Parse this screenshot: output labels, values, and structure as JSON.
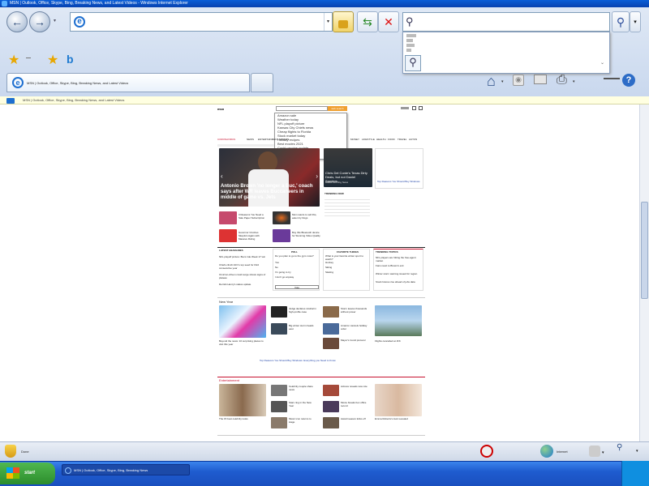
{
  "window": {
    "title": "MSN | Outlook, Office, Skype, Bing, Breaking News, and Latest Videos - Windows Internet Explorer"
  },
  "toolbar": {
    "address_value": "",
    "search_value": "",
    "search_dropdown_item": "Bing"
  },
  "tab": {
    "label": "MSN | Outlook, Office, Skype, Bing, Breaking News, and Latest Videos"
  },
  "infobar": {
    "text": "MSN | Outlook, Office, Skype, Bing, Breaking News, and Latest Videos"
  },
  "msn": {
    "logo": "msn",
    "search_button": "web search",
    "search_suggestions": [
      "Amazon sale",
      "Weather today",
      "NFL playoff picture",
      "Kansas City Chiefs news",
      "Cheap flights to Florida",
      "Stock market today",
      "Holiday recipes",
      "Best movies 2021",
      "Covid vaccine update",
      "Local news"
    ],
    "nav": [
      "CORONAVIRUS",
      "NEWS",
      "ENTERTAINMENT",
      "SPORTS",
      "MONEY",
      "LIFESTYLE",
      "HEALTH",
      "FOOD",
      "TRAVEL",
      "AUTOS",
      "VIDEO",
      "SHOPPING"
    ],
    "hero_caption": "Antonio Brown 'no longer a Buc,' coach says after WR leaves Buccaneers in middle of game vs. Jets",
    "side_story": "Chris Del Conte's Texas Dirty Deals, but not Daniel Sanders...",
    "side_story_link": "Dallas Morning News",
    "side_ad": "Top Reasons You Should Buy Windows",
    "trending_label": "TRENDING NOW",
    "small_stories": [
      "3 Reasons You Need a Sale Paper Subscription",
      "Mom wants to sell this, eaten by Dogs",
      "Governor Crushes Skeptics Again with Massive Ruling",
      "Buy this Bluetooth device for Stunning Video Quality"
    ],
    "latest_label": "LATEST HEADLINES",
    "latest": [
      "NFL playoff picture: Bucs ride Week 17 win",
      "Chiefs clinch AFC's top seed for third consecutive year",
      "Omicron-driven covid surge shows signs of plateau",
      "Derrick Henry's status update"
    ],
    "poll1_label": "POLL",
    "poll1_q": "Do you plan to go to the gym more?",
    "poll1_options": [
      "Yes",
      "No",
      "I'm going to try",
      "I don't go anyway"
    ],
    "poll1_button": "Vote",
    "poll2_label": "FAVORITE THINGS",
    "poll2_q": "What is your favorite winter sport to watch?",
    "poll2_options": [
      "Hockey",
      "Skiing",
      "Skating"
    ],
    "trending2_label": "TRENDING TOPICS",
    "trending2": [
      "NFL players are hitting the free-agent market",
      "Fans react to Brown's exit",
      "Winter storm warning issued for region",
      "Stock futures rise ahead of jobs data"
    ],
    "news_label": "New Year",
    "news_caption": "Beyond the news: 10 surprising places to visit this year",
    "news_items": [
      "Judge declares mistrial in high-profile case",
      "Big winter storm heads east",
      "Storm leaves thousands without power",
      "Amazon cancels holiday order",
      "Mayor's Covid protocol",
      "Flights cancelled at JFK"
    ],
    "sponsored": "Top Reasons You Should Buy Windows: Everything you Need to Know",
    "ent_label": "Entertainment",
    "ent_items": [
      "Celebrity couple share news",
      "Stars ring in the New Year",
      "Music icon returns to stage",
      "Actress reveals new role",
      "Movie breaks box office record",
      "Award season kicks off"
    ],
    "ent_caption1": "The 15 best celebrity looks",
    "ent_caption2": "Emma Roberts's look revealed"
  },
  "statusbar": {
    "left_text": "Done",
    "zone": "Internet"
  },
  "taskbar": {
    "start_label": "start",
    "task_label": "MSN | Outlook, Office, Skype, Bing, Breaking News"
  },
  "colors": {
    "titlebar": "#0842b0",
    "taskbar": "#1f5ccf",
    "msn_red": "#c8102e",
    "start_green": "#2c8d2c"
  }
}
